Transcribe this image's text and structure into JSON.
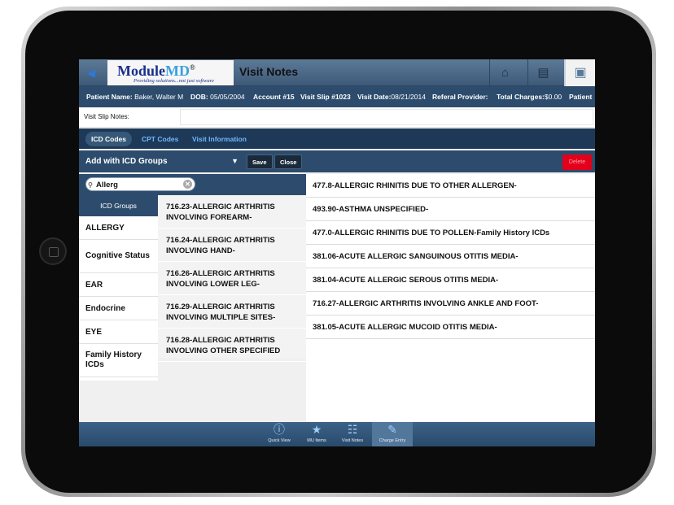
{
  "header": {
    "logo_text_main": "Module",
    "logo_text_accent": "MD",
    "logo_mark": "®",
    "logo_tagline": "Providing solutions...not just software",
    "title": "Visit Notes",
    "icons": [
      "back-arrow-icon",
      "home-icon",
      "doctor-bag-icon",
      "certificate-icon"
    ]
  },
  "patient": {
    "name_label": "Patient Name:",
    "name": "Baker, Walter M",
    "dob_label": "DOB:",
    "dob": "05/05/2004",
    "account_label": "Account #15",
    "visit_slip_label": "Visit Slip #1023",
    "visit_date_label": "Visit Date:",
    "visit_date": "08/21/2014",
    "referal_label": "Referal Provider:",
    "charges_label": "Total Charges:",
    "charges": "$0.00",
    "trailing": "Patient"
  },
  "notes": {
    "label": "Visit Slip Notes:",
    "value": ""
  },
  "tabs": [
    {
      "label": "ICD Codes",
      "active": true
    },
    {
      "label": "CPT Codes",
      "active": false
    },
    {
      "label": "Visit Information",
      "active": false
    }
  ],
  "actions": {
    "group_select": "Add with ICD Groups",
    "save": "Save",
    "close": "Close",
    "delete": "Delete"
  },
  "search": {
    "value": "Allerg"
  },
  "groups": {
    "header": "ICD Groups",
    "items": [
      "ALLERGY",
      "Cognitive Status",
      "EAR",
      "Endocrine",
      "EYE",
      "Family History ICDs"
    ]
  },
  "codes": [
    "716.23-ALLERGIC ARTHRITIS INVOLVING FOREARM-",
    "716.24-ALLERGIC ARTHRITIS INVOLVING HAND-",
    "716.26-ALLERGIC ARTHRITIS INVOLVING LOWER LEG-",
    "716.29-ALLERGIC ARTHRITIS INVOLVING MULTIPLE SITES-",
    "716.28-ALLERGIC ARTHRITIS INVOLVING OTHER SPECIFIED"
  ],
  "selected": [
    "477.8-ALLERGIC RHINITIS DUE TO OTHER ALLERGEN-",
    "493.90-ASTHMA UNSPECIFIED-",
    "477.0-ALLERGIC RHINITIS DUE TO POLLEN-Family History ICDs",
    "381.06-ACUTE ALLERGIC SANGUINOUS OTITIS MEDIA-",
    "381.04-ACUTE ALLERGIC SEROUS OTITIS MEDIA-",
    "716.27-ALLERGIC ARTHRITIS INVOLVING ANKLE AND FOOT-",
    "381.05-ACUTE ALLERGIC MUCOID OTITIS MEDIA-"
  ],
  "bottom_nav": [
    {
      "label": "Quick View",
      "icon": "info-icon"
    },
    {
      "label": "MU Items",
      "icon": "star-icon"
    },
    {
      "label": "Visit Notes",
      "icon": "book-icon"
    },
    {
      "label": "Charge Entry",
      "icon": "edit-icon",
      "active": true
    }
  ]
}
